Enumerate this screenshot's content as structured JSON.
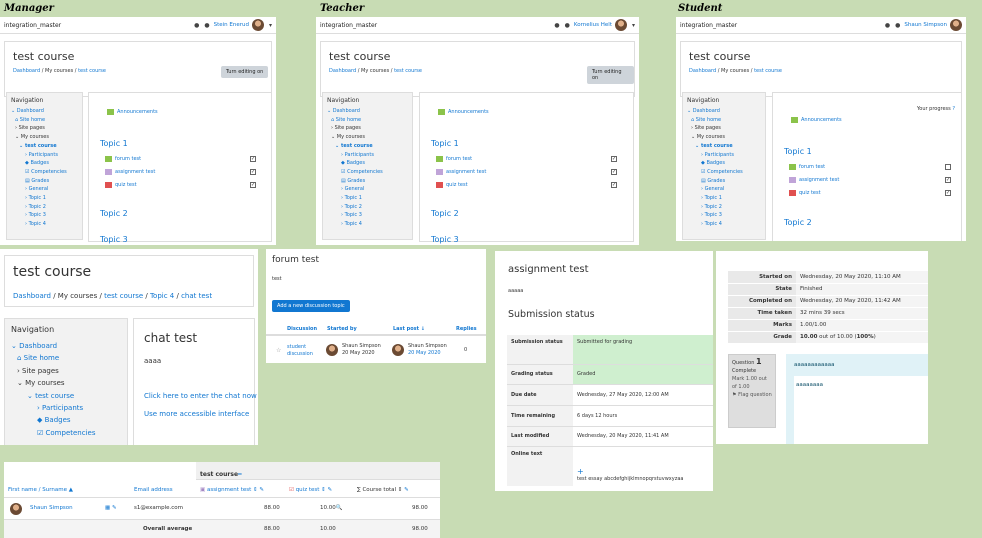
{
  "roles": {
    "manager": "Manager",
    "teacher": "Teacher",
    "student": "Student"
  },
  "site": "integration_master",
  "users": {
    "manager": "Stein Enerud",
    "teacher": "Kornelius Helt",
    "student": "Shaun Simpson"
  },
  "course": {
    "title": "test course",
    "crumbs": [
      "Dashboard",
      "My courses",
      "test course"
    ],
    "edit_btn": "Turn editing on"
  },
  "nav": {
    "title": "Navigation",
    "items": [
      "Dashboard",
      "Site home",
      "Site pages",
      "My courses",
      "test course",
      "Participants",
      "Badges",
      "Competencies",
      "Grades",
      "General",
      "Topic 1",
      "Topic 2",
      "Topic 3",
      "Topic 4"
    ]
  },
  "sections": {
    "announcements": "Announcements",
    "topic1": "Topic 1",
    "topic2": "Topic 2",
    "topic3": "Topic 3",
    "forum": "forum test",
    "assign": "assignment test",
    "quiz": "quiz test",
    "progress": "Your progress"
  },
  "chat": {
    "title": "test course",
    "crumbs": [
      "Dashboard",
      "My courses",
      "test course",
      "Topic 4",
      "chat test"
    ],
    "nav_title": "Navigation",
    "nav": [
      "Dashboard",
      "Site home",
      "Site pages",
      "My courses",
      "test course",
      "Participants",
      "Badges",
      "Competencies"
    ],
    "heading": "chat test",
    "desc": "aaaa",
    "link1": "Click here to enter the chat now",
    "link2": "Use more accessible interface"
  },
  "forum": {
    "title": "forum test",
    "desc": "test",
    "btn": "Add a new discussion topic",
    "headers": [
      "Discussion",
      "Started by",
      "Last post",
      "Replies"
    ],
    "row": {
      "discussion": "student discussion",
      "starter": "Shaun Simpson",
      "started": "20 May 2020",
      "lastby": "Shaun Simpson",
      "lastdate": "20 May 2020",
      "replies": "0"
    }
  },
  "assignment": {
    "title": "assignment test",
    "desc": "aaaaa",
    "status_heading": "Submission status",
    "rows": [
      [
        "Submission status",
        "Submitted for grading"
      ],
      [
        "Grading status",
        "Graded"
      ],
      [
        "Due date",
        "Wednesday, 27 May 2020, 12:00 AM"
      ],
      [
        "Time remaining",
        "6 days 12 hours"
      ],
      [
        "Last modified",
        "Wednesday, 20 May 2020, 11:41 AM"
      ],
      [
        "Online text",
        ""
      ]
    ],
    "online_text": "test essay abcdefghijklmnopqrstuvwxyzaa"
  },
  "quiz": {
    "rows": [
      [
        "Started on",
        "Wednesday, 20 May 2020, 11:10 AM"
      ],
      [
        "State",
        "Finished"
      ],
      [
        "Completed on",
        "Wednesday, 20 May 2020, 11:42 AM"
      ],
      [
        "Time taken",
        "32 mins 39 secs"
      ],
      [
        "Marks",
        "1.00/1.00"
      ]
    ],
    "grade_label": "Grade",
    "grade_pre": "10.00",
    "grade_mid": " out of 10.00 (",
    "grade_pct": "100%",
    "grade_post": ")",
    "q_label": "Question",
    "q_num": "1",
    "q_state": "Complete",
    "q_mark": "Mark 1.00 out of 1.00",
    "q_flag": "Flag question",
    "q_text": "aaaaaaaaaaaa",
    "q_answer": "aaaaaaaa"
  },
  "grader": {
    "course": "test course",
    "headers": [
      "First name / Surname",
      "Email address",
      "assignment test",
      "quiz test",
      "Course total"
    ],
    "row": {
      "name": "Shaun Simpson",
      "email": "s1@example.com",
      "assign": "88.00",
      "quiz": "10.00",
      "total": "98.00"
    },
    "avg": {
      "label": "Overall average",
      "assign": "88.00",
      "quiz": "10.00",
      "total": "98.00"
    }
  }
}
